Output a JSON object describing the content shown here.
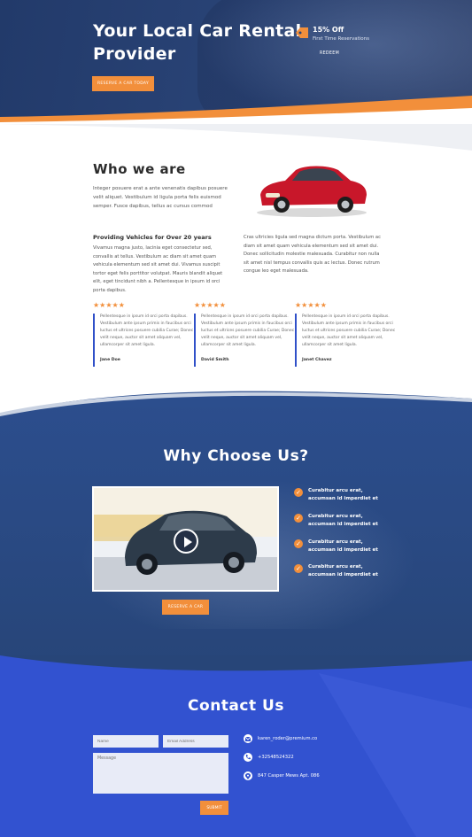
{
  "hero": {
    "title": "Your Local Car Rental Provider",
    "cta_label": "RESERVE A CAR TODAY",
    "offer_title": "15% Off",
    "offer_subtitle": "First Time Reservations",
    "offer_cta": "REDEEM"
  },
  "about": {
    "title": "Who we are",
    "intro": "Integer posuere erat a ante venenatis dapibus posuere velit aliquet. Vestibulum id ligula porta felis euismod semper. Fusce dapibus, tellus ac cursus commod",
    "left_title": "Providing Vehicles for Over 20 years",
    "left_text": "Vivamus magna justo, lacinia eget consectetur sed, convallis at tellus. Vestibulum ac diam sit amet quam vehicula elementum sed sit amet dui. Vivamus suscipit tortor eget felis porttitor volutpat. Mauris blandit aliquet elit, eget tincidunt nibh a. Pellentesque in ipsum id orci porta dapibus.",
    "right_text": "Cras ultricies ligula sed magna dictum porta. Vestibulum ac diam sit amet quam vehicula elementum sed sit amet dui. Donec sollicitudin molestie malesuada. Curabitur non nulla sit amet nisl tempus convallis quis ac lectus. Donec rutrum congue leo eget malesuada."
  },
  "testimonials": [
    {
      "stars": "★★★★★",
      "text": "Pellentesque in ipsum id orci porta dapibus. Vestibulum ante ipsum primis in faucibus orci luctus et ultrices posuere cubilia Curae; Donec velit neque, auctor sit amet aliquam vel, ullamcorper sit amet ligula.",
      "name": "Jane Doe"
    },
    {
      "stars": "★★★★★",
      "text": "Pellentesque in ipsum id orci porta dapibus. Vestibulum ante ipsum primis in faucibus orci luctus et ultrices posuere cubilia Curae; Donec velit neque, auctor sit amet aliquam vel, ullamcorper sit amet ligula.",
      "name": "David Smith"
    },
    {
      "stars": "★★★★★",
      "text": "Pellentesque in ipsum id orci porta dapibus. Vestibulum ante ipsum primis in faucibus orci luctus et ultrices posuere cubilia Curae; Donec velit neque, auctor sit amet aliquam vel, ullamcorper sit amet ligula.",
      "name": "Janet Chavez"
    }
  ],
  "why": {
    "title": "Why Choose Us?",
    "cta_label": "RESERVE A CAR",
    "features": [
      "Curabitur arcu erat, accumsan id imperdiet et",
      "Curabitur arcu erat, accumsan id imperdiet et",
      "Curabitur arcu erat, accumsan id imperdiet et",
      "Curabitur arcu erat, accumsan id imperdiet et"
    ]
  },
  "contact": {
    "title": "Contact Us",
    "name_placeholder": "Name",
    "email_placeholder": "Email Address",
    "message_placeholder": "Message",
    "submit_label": "SUBMIT",
    "email": "karen_roder@premium.co",
    "phone": "+32548524322",
    "address": "847 Casper Mews Apt. 086"
  },
  "colors": {
    "accent": "#f28f3b",
    "navy": "#223a6a",
    "contact_blue": "#3252d0",
    "quote_border": "#3050c8"
  },
  "icons": [
    "tag-icon",
    "play-icon",
    "check-icon",
    "mail-icon",
    "phone-icon",
    "location-icon",
    "star-icon"
  ]
}
